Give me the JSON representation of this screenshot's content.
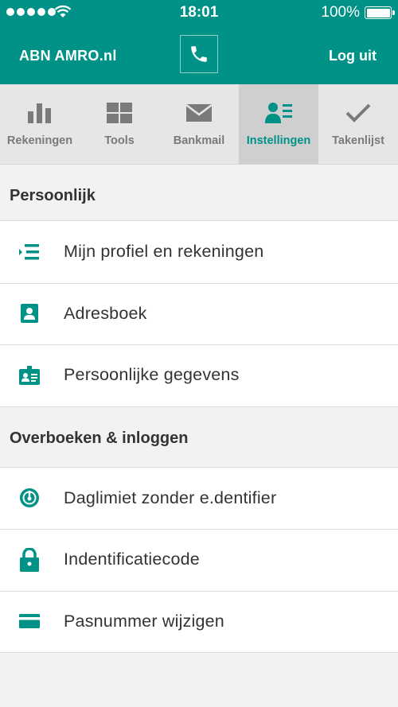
{
  "status_bar": {
    "time": "18:01",
    "battery": "100%",
    "signal_bars": 5
  },
  "header": {
    "brand": "ABN AMRO.nl",
    "logout_label": "Log uit",
    "phone_icon": "phone-icon"
  },
  "tabs": [
    {
      "label": "Rekeningen",
      "icon": "bar-chart-icon",
      "active": false
    },
    {
      "label": "Tools",
      "icon": "grid-icon",
      "active": false
    },
    {
      "label": "Bankmail",
      "icon": "envelope-icon",
      "active": false
    },
    {
      "label": "Instellingen",
      "icon": "user-settings-icon",
      "active": true
    },
    {
      "label": "Takenlijst",
      "icon": "checkmark-icon",
      "active": false
    }
  ],
  "sections": [
    {
      "title": "Persoonlijk",
      "items": [
        {
          "label": "Mijn profiel en rekeningen",
          "icon": "list-icon"
        },
        {
          "label": "Adresboek",
          "icon": "contact-book-icon"
        },
        {
          "label": "Persoonlijke gegevens",
          "icon": "id-card-icon"
        }
      ]
    },
    {
      "title": "Overboeken & inloggen",
      "items": [
        {
          "label": "Daglimiet zonder e.dentifier",
          "icon": "gauge-icon"
        },
        {
          "label": "Indentificatiecode",
          "icon": "lock-icon"
        },
        {
          "label": "Pasnummer wijzigen",
          "icon": "card-icon"
        }
      ]
    }
  ],
  "colors": {
    "brand": "#009286",
    "tab_bg": "#e6e6e6",
    "tab_active_bg": "#cfcfcf",
    "icon_gray": "#7a7a7a"
  }
}
